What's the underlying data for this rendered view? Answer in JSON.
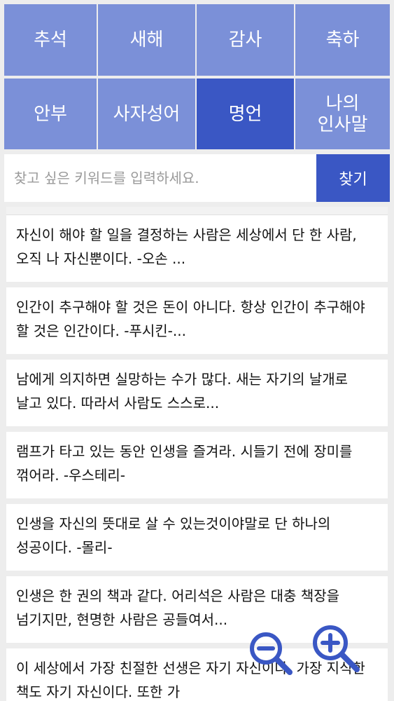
{
  "categories": [
    {
      "label": "추석",
      "active": false
    },
    {
      "label": "새해",
      "active": false
    },
    {
      "label": "감사",
      "active": false
    },
    {
      "label": "축하",
      "active": false
    },
    {
      "label": "안부",
      "active": false
    },
    {
      "label": "사자성어",
      "active": false
    },
    {
      "label": "명언",
      "active": true
    },
    {
      "label": "나의\n인사말",
      "active": false
    }
  ],
  "search": {
    "placeholder": "찾고 싶은 키워드를 입력하세요.",
    "value": "",
    "button_label": "찾기"
  },
  "quotes": [
    "자신이 해야 할 일을 결정하는 사람은 세상에서 단 한 사람, 오직 나 자신뿐이다. -오손 ...",
    "인간이 추구해야 할 것은 돈이 아니다. 항상 인간이 추구해야 할 것은 인간이다. -푸시킨-...",
    "남에게 의지하면 실망하는 수가 많다. 새는 자기의 날개로 날고 있다. 따라서 사람도 스스로...",
    "램프가 타고 있는 동안 인생을 즐겨라. 시들기 전에 장미를 꺾어라. -우스테리-",
    "인생을 자신의 뜻대로 살 수 있는것이야말로 단 하나의 성공이다. -몰리-",
    "인생은 한 권의 책과 같다. 어리석은 사람은 대충 책장을 넘기지만, 현명한 사람은 공들여서...",
    "이 세상에서 가장 친절한 선생은 자기 자신이다. 가장 지식한 책도 자기 자신이다. 또한 가"
  ],
  "zoom": {
    "out_icon": "zoom-out-icon",
    "in_icon": "zoom-in-icon",
    "color": "#3a57c4"
  },
  "colors": {
    "category_bg": "#7b90d8",
    "category_active_bg": "#3a57c4",
    "search_button_bg": "#3a57c4"
  }
}
